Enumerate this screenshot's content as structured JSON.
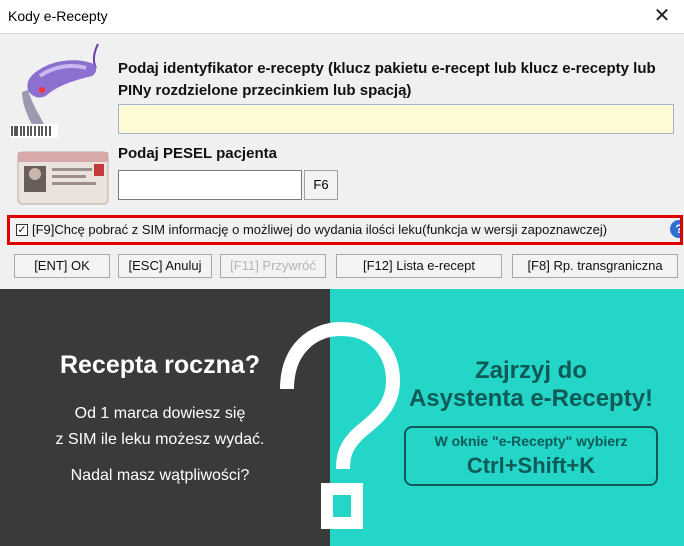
{
  "window": {
    "title": "Kody e-Recepty",
    "close_symbol": "✕"
  },
  "form": {
    "id_label": "Podaj identyfikator e-recepty (klucz pakietu e-recept lub klucz e-recepty lub PINy rozdzielone przecinkiem lub spacją)",
    "id_value": "",
    "pesel_label": "Podaj PESEL pacjenta",
    "pesel_value": "",
    "f6_label": "F6"
  },
  "sim_option": {
    "checked": true,
    "check_symbol": "✓",
    "label": "[F9]Chcę pobrać z SIM informację o możliwej do wydania ilości leku(funkcja w wersji zapoznawczej)",
    "help_symbol": "?"
  },
  "buttons": {
    "ok": "[ENT] OK",
    "cancel": "[ESC] Anuluj",
    "restore": "[F11] Przywróć",
    "list": "[F12] Lista e-recept",
    "cross_border": "[F8] Rp. transgraniczna"
  },
  "banner": {
    "left_title": "Recepta roczna?",
    "left_line1": "Od 1 marca dowiesz się",
    "left_line2": "z SIM ile leku możesz wydać.",
    "left_line3": "Nadal masz wątpliwości?",
    "right_title1": "Zajrzyj do",
    "right_title2": "Asystenta e-Recepty!",
    "box_line1": "W oknie \"e-Recepty\" wybierz",
    "box_line2": "Ctrl+Shift+K",
    "colors": {
      "dark": "#3a3a3a",
      "teal": "#23d6c8",
      "text_dark": "#0f5a57"
    }
  },
  "icons": {
    "scanner": "barcode-scanner-icon",
    "id_card": "id-card-icon",
    "question": "question-mark-icon"
  }
}
